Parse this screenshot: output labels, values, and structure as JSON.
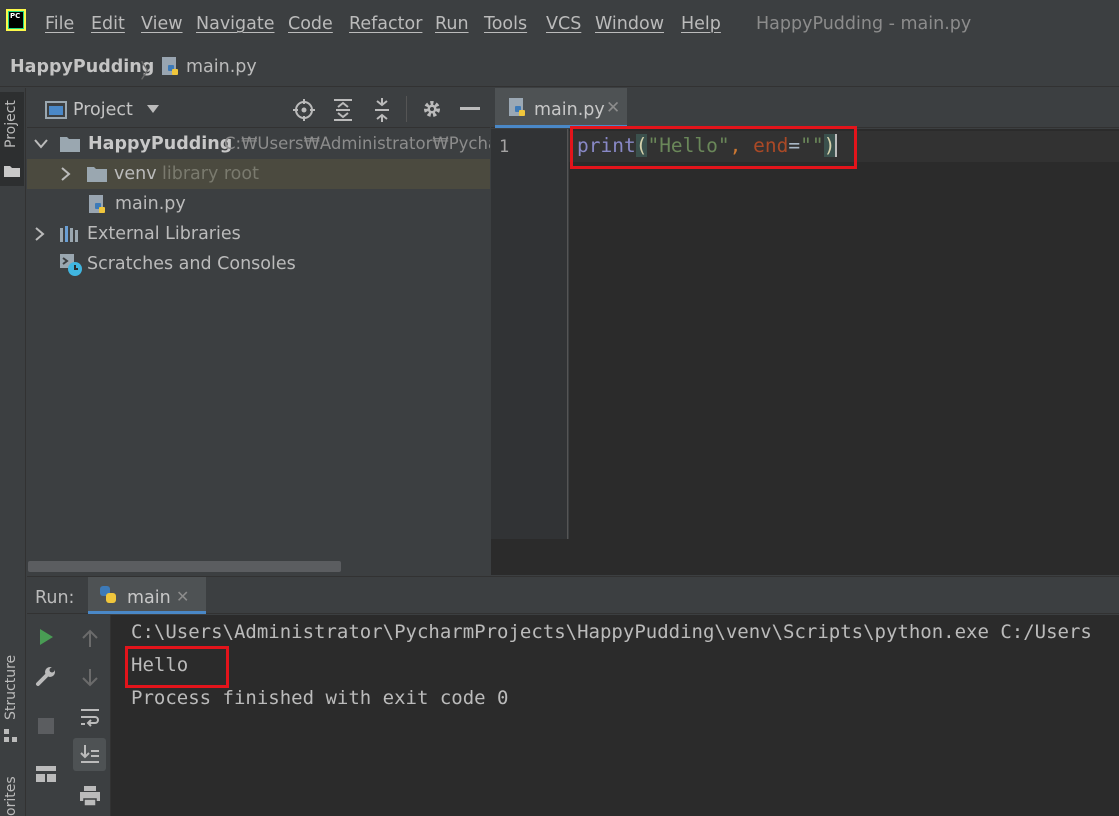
{
  "menubar": {
    "logo_text": "PC",
    "items": [
      "File",
      "Edit",
      "View",
      "Navigate",
      "Code",
      "Refactor",
      "Run",
      "Tools",
      "VCS",
      "Window",
      "Help"
    ],
    "window_title": "HappyPudding - main.py"
  },
  "breadcrumb": {
    "project": "HappyPudding",
    "file": "main.py"
  },
  "side_stripe": {
    "project_label": "Project",
    "structure_label": "Structure",
    "favorites_label": "orites"
  },
  "project_panel": {
    "title": "Project",
    "tree": [
      {
        "label": "HappyPudding",
        "path": "C:\\Users\\Administrator\\PycharmProjects\\HappyPudding",
        "path_visible": "C:₩Users₩Administrator₩Pycharm",
        "expanded": true
      },
      {
        "label": "venv",
        "suffix": "library root",
        "expanded": false
      },
      {
        "label": "main.py"
      },
      {
        "label": "External Libraries",
        "expanded": false
      },
      {
        "label": "Scratches and Consoles"
      }
    ]
  },
  "editor": {
    "tab_label": "main.py",
    "line_number": "1",
    "code": {
      "fn": "print",
      "open_paren": "(",
      "string1": "\"Hello\"",
      "comma": ", ",
      "kw": "end",
      "eq": "=",
      "string2": "\"\"",
      "close_paren": ")"
    }
  },
  "run_panel": {
    "label": "Run:",
    "tab_label": "main",
    "console": [
      "C:\\Users\\Administrator\\PycharmProjects\\HappyPudding\\venv\\Scripts\\python.exe C:/Users",
      "Hello",
      "Process finished with exit code 0"
    ]
  },
  "colors": {
    "accent_blue": "#4a88c7",
    "highlight_red": "#e3141b",
    "keyword_orange": "#cc7832",
    "string_green": "#6a8759",
    "builtin_purple": "#8888c6",
    "run_green": "#499c54"
  }
}
